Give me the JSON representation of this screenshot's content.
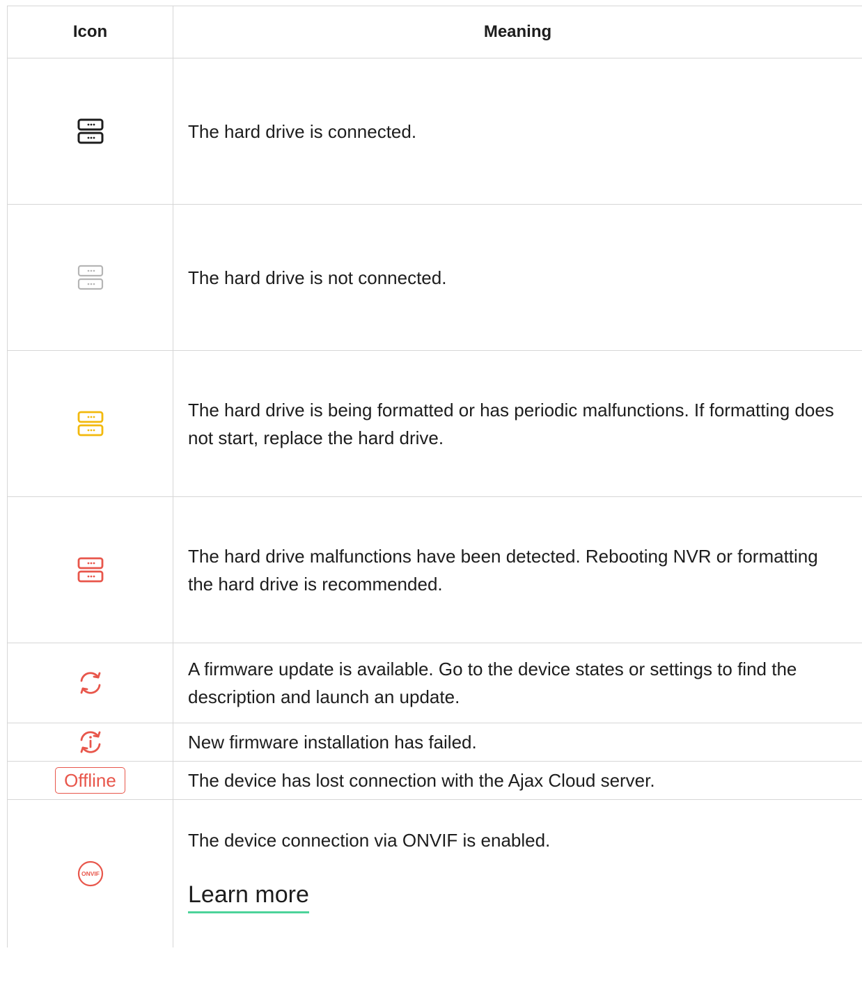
{
  "table": {
    "headers": {
      "icon": "Icon",
      "meaning": "Meaning"
    },
    "rows": [
      {
        "icon": "hdd-connected-icon",
        "icon_color": "#1d1d1d",
        "text": "The hard drive is connected."
      },
      {
        "icon": "hdd-not-connected-icon",
        "icon_color": "#b5b5b5",
        "text": "The hard drive is not connected."
      },
      {
        "icon": "hdd-formatting-icon",
        "icon_color": "#f2b90d",
        "text": "The hard drive is being formatted or has periodic malfunctions. If formatting does not start, replace the hard drive."
      },
      {
        "icon": "hdd-malfunction-icon",
        "icon_color": "#e8564b",
        "text": "The hard drive malfunctions have been detected. Rebooting NVR or formatting the hard drive is recommended."
      },
      {
        "icon": "firmware-update-icon",
        "icon_color": "#e8564b",
        "text": "A firmware update is available. Go to the device states or settings to find the description and launch an update."
      },
      {
        "icon": "firmware-failed-icon",
        "icon_color": "#e8564b",
        "text": "New firmware installation has failed."
      },
      {
        "icon": "offline-badge",
        "icon_color": "#e8564b",
        "badge_label": "Offline",
        "text": "The device has lost connection with the Ajax Cloud server."
      },
      {
        "icon": "onvif-icon",
        "icon_color": "#e8564b",
        "badge_label": "ONVIF",
        "text": "The device connection via ONVIF is enabled.",
        "link_label": "Learn more"
      }
    ]
  },
  "colors": {
    "border": "#d6d6d6",
    "link_underline": "#4cd39a",
    "text": "#1d1d1d"
  }
}
